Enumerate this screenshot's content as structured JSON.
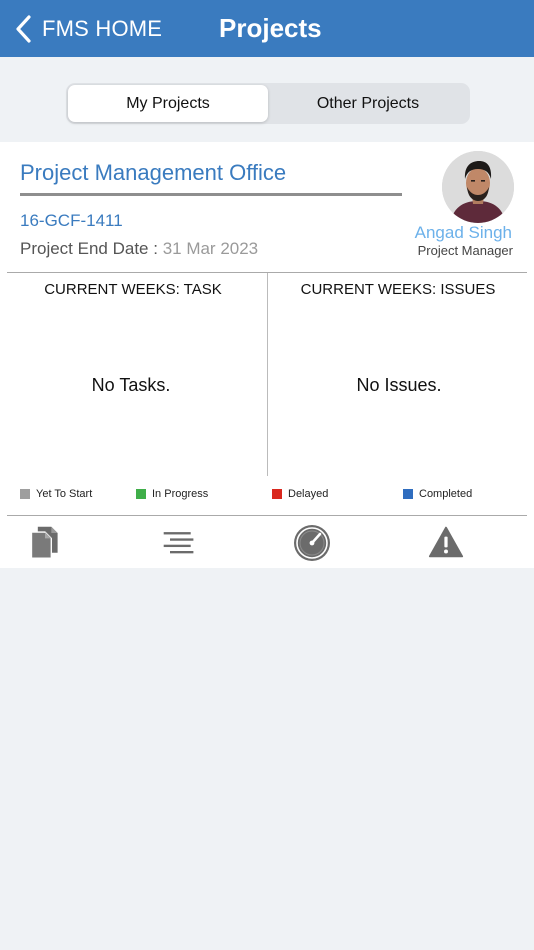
{
  "nav": {
    "back_label": "FMS HOME",
    "title": "Projects"
  },
  "segments": [
    {
      "label": "My  Projects",
      "active": true
    },
    {
      "label": "Other Projects",
      "active": false
    }
  ],
  "project": {
    "name": "Project Management Office",
    "code": "16-GCF-1411",
    "end_date_label": "Project End Date : ",
    "end_date_value": "31 Mar 2023",
    "manager_name": "Angad Singh",
    "manager_role": "Project Manager"
  },
  "tasks": {
    "heading": "CURRENT WEEKS: TASK",
    "empty_text": "No Tasks."
  },
  "issues": {
    "heading": "CURRENT WEEKS: ISSUES",
    "empty_text": "No Issues."
  },
  "legend": [
    {
      "label": "Yet To Start",
      "color": "#9e9e9e"
    },
    {
      "label": "In Progress",
      "color": "#3fae49"
    },
    {
      "label": "Delayed",
      "color": "#d9281e"
    },
    {
      "label": "Completed",
      "color": "#2f6dbf"
    }
  ],
  "toolbar_icons": [
    "documents-icon",
    "list-icon",
    "gauge-icon",
    "warning-icon"
  ],
  "colors": {
    "nav_bg": "#3a7bbf",
    "accent": "#3a7bbf",
    "manager_name": "#6cb1ea",
    "icon": "#6b6b6b"
  }
}
